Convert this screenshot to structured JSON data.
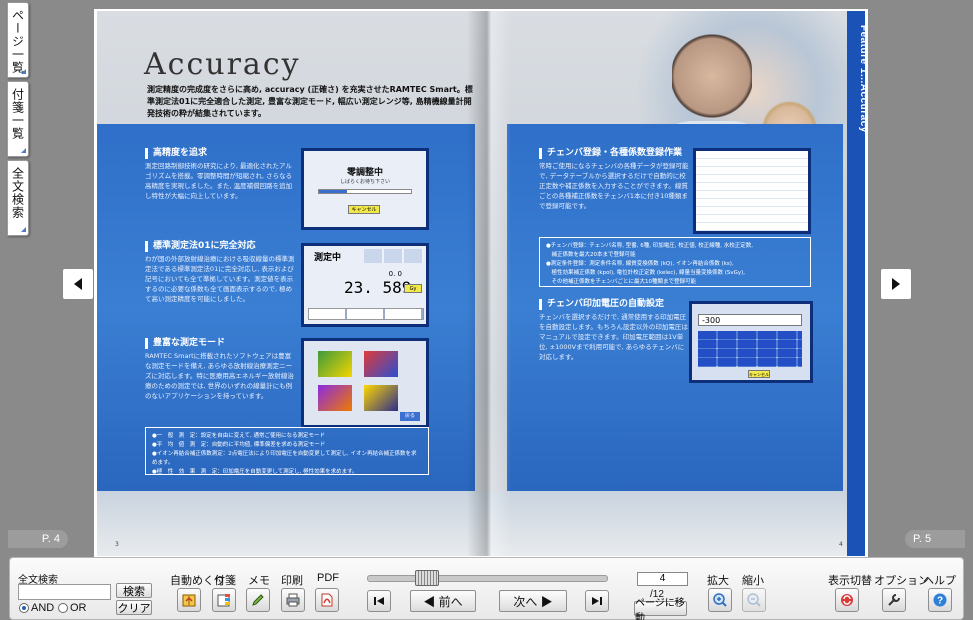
{
  "side_tabs": [
    "ページ一覧",
    "付箋一覧",
    "全文検索"
  ],
  "page_labels": {
    "left": "P. 4",
    "right": "P. 5"
  },
  "book": {
    "title": "Accuracy",
    "lead": "測定精度の完成度をさらに高め, accuracy (正確さ) を充実させたRAMTEC Smart。標準測定法01に完全適合した測定, 豊富な測定モード, 幅広い測定レンジ等, 島精機線量計開発技術の粋が結集されています。",
    "feature_strip": "Feature 1...Accuracy",
    "sections_left": [
      {
        "head": "高精度を追求",
        "body": "測定回路制御技術の研究により, 最適化されたアルゴリズムを搭載。零調整時間が短縮され, さらなる高精度を実現しました。また, 温度補償回路を追加し特性が大幅に向上しています。"
      },
      {
        "head": "標準測定法01に完全対応",
        "body": "わが国の外部放射線治療における吸収線量の標準測定法である標準測定法01に完全対応し, 表示および記号においても全て準拠しています。測定値を表示するのに必要な係数も全て画面表示するので, 極めて高い測定精度を可能にしました。"
      },
      {
        "head": "豊富な測定モード",
        "body": "RAMTEC Smartに搭載されたソフトウェアは豊富な測定モードを備え, あらゆる放射線治療測定ニーズに対応します。特に医療用高エネルギー放射線治療のための測定では, 世界のいずれの線量計にも例のないアプリケーションを持っています。"
      }
    ],
    "sections_right": [
      {
        "head": "チェンバ登録・各種係数登録作業",
        "body": "常時ご使用になるチェンバの各種データが登録可能で, データテーブルから選択するだけで自動的に校正定数や補正係数を入力することができます。線質ごとの各種補正係数をチェンバ1本に付き10種類まで登録可能です。"
      },
      {
        "head": "チェンバ印加電圧の自動設定",
        "body": "チェンバを選択するだけで, 通常使用する印加電圧を自動設定します。もちろん設定以外の印加電圧はマニュアルで設定できます。印加電圧範囲は1V単位, ±1000Vまで利用可能で, あらゆるチェンバに対応します。"
      }
    ],
    "bullets_left": [
      "●一　般　測　定：設定を自由に変えて, 通常ご使用になる測定モード",
      "●平　均　値　測　定：自動的に平均値, 標準偏差を求める測定モード",
      "●イオン再結合補正係数測定：2点電圧法により印加電圧を自動変更して測定し, イオン再結合補正係数を求めます。",
      "●極　性　効　果　測　定：印加電圧を自動変更して測定し, 極性効果を求めます。"
    ],
    "bullets_right": [
      "●チェンバ登録：チェンバ名称, 型番, 6種, 印加電圧, 校正値, 校正線種, 水校正定数,",
      "　補正係数を最大20本まで登録可能",
      "●測定条件登録：測定条件名称, 線質変換係数 (kQ), イオン再結合係数 (ks),",
      "　極性効果補正係数 (kpol), 電位計校正定数 (kelec), 線量当量変換係数 (SvGy),",
      "　その他補正係数をチェンバごとに最大10種類まで登録可能"
    ],
    "screens": {
      "zero": {
        "title": "零調整中",
        "sub": "しばらくお待ち下さい",
        "cancel": "キャンセル"
      },
      "measuring": {
        "title": "測定中",
        "value": "23. 589",
        "unit": "Gy",
        "sub": "0. 0"
      },
      "mode": {
        "btn": "戻る"
      },
      "voltage": {
        "value": "-300",
        "ok": "キャンセル"
      }
    },
    "page_left": "3",
    "page_right": "4"
  },
  "toolbar": {
    "search_label": "全文検索",
    "search_button": "検索",
    "clear_button": "クリア",
    "and_label": "AND",
    "or_label": "OR",
    "auto_flip": "自動めくり",
    "sticky": "付箋",
    "memo": "メモ",
    "print": "印刷",
    "pdf": "PDF",
    "prev": "◀ 前へ",
    "next": "次へ ▶",
    "page_value": "4",
    "page_total": "/12",
    "goto_page": "ページに移動",
    "zoom_in": "拡大",
    "zoom_out": "縮小",
    "view_switch": "表示切替",
    "options": "オプション",
    "help": "ヘルプ"
  },
  "colors": {
    "accent": "#2f6fc9",
    "strip": "#1a52b6",
    "pdf_red": "#d23a2a",
    "help_blue": "#2e7fd8"
  }
}
